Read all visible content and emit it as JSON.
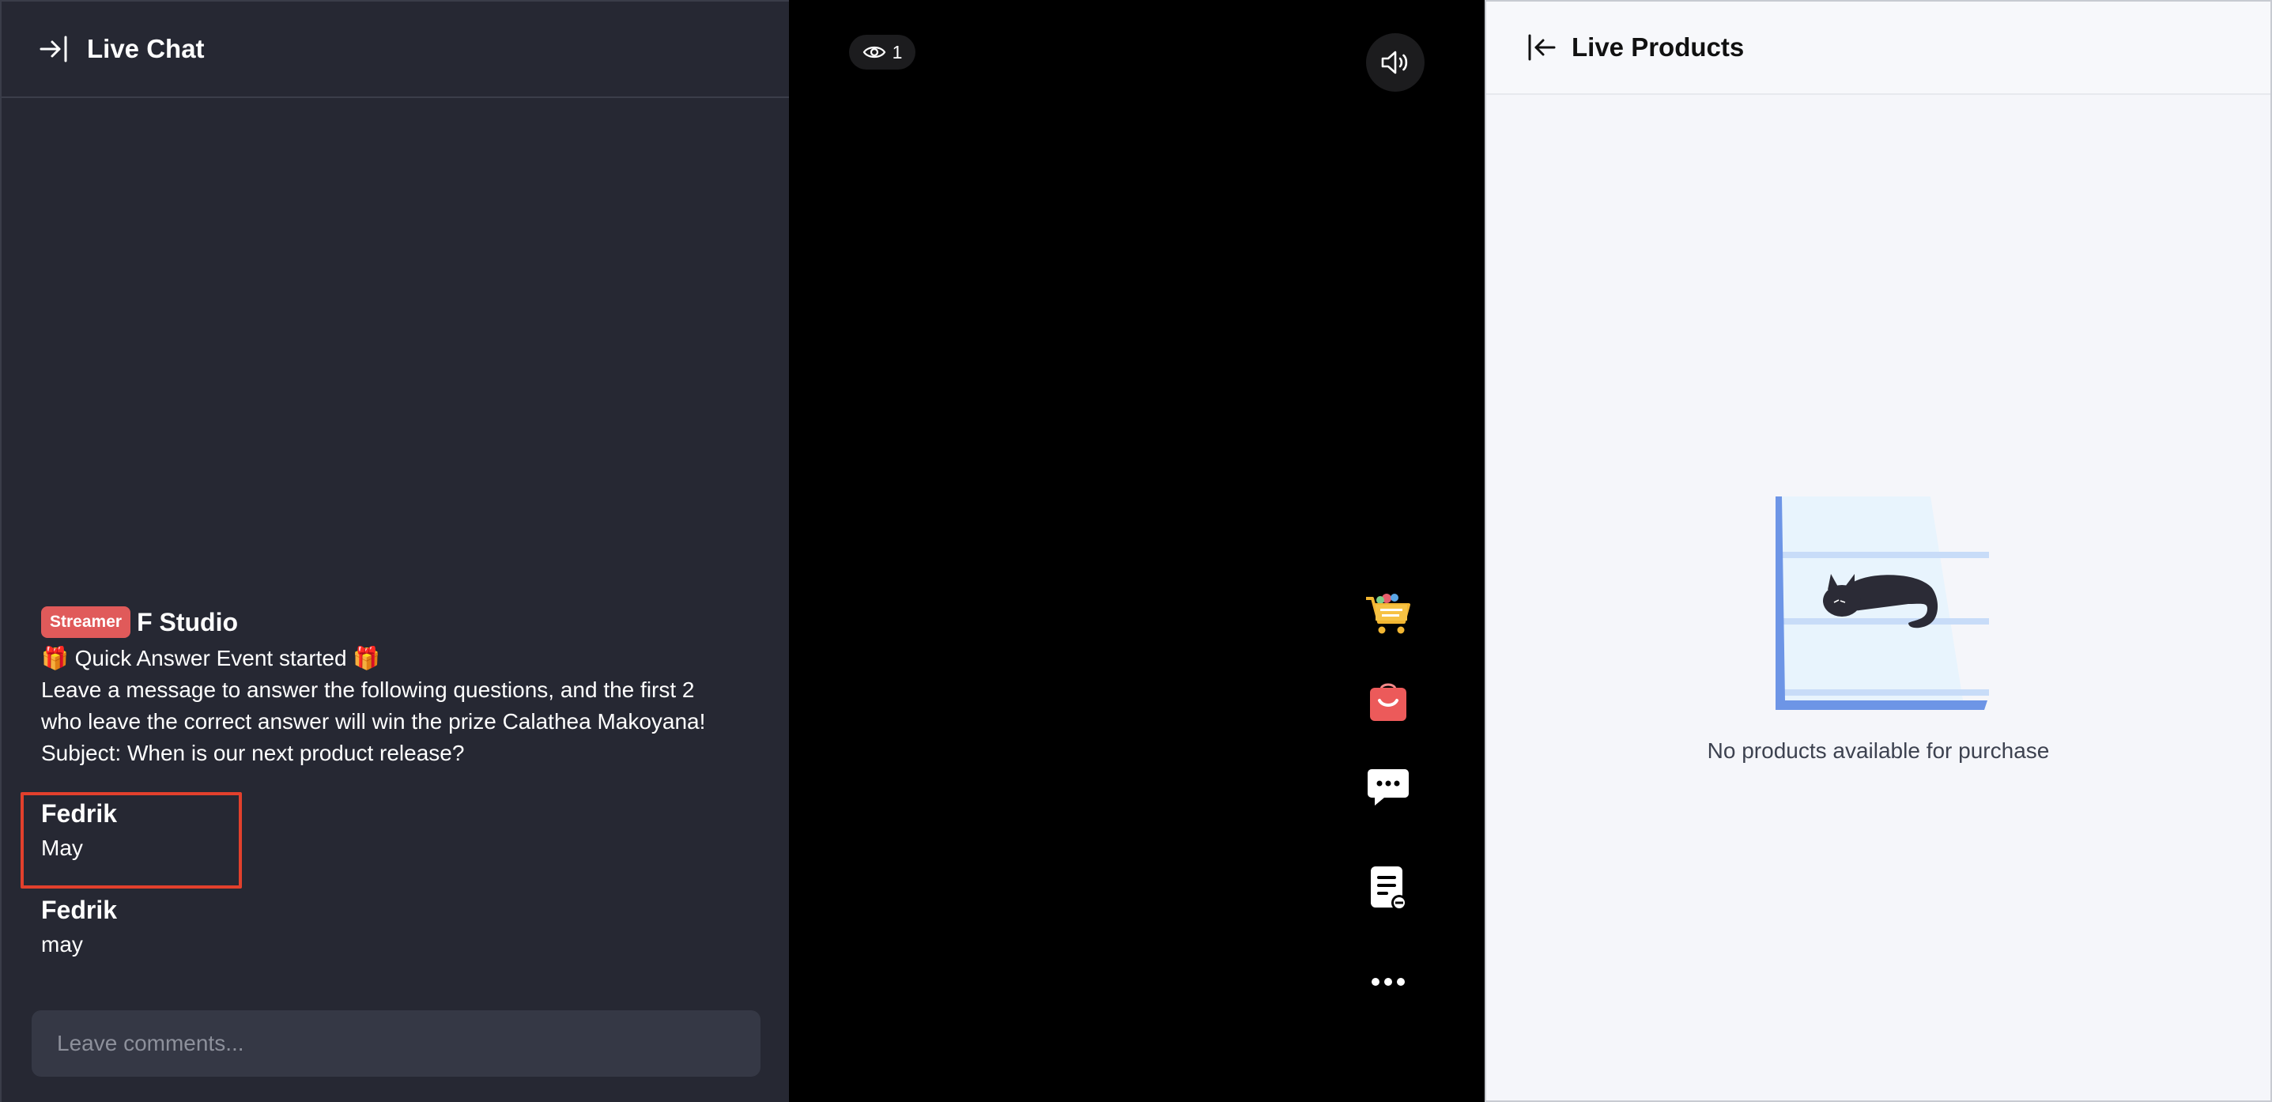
{
  "chat": {
    "title": "Live Chat",
    "streamer_badge": "Streamer",
    "streamer_name": "F Studio",
    "streamer_message": [
      "🎁 Quick Answer Event started 🎁",
      "Leave a message to answer the following questions, and the first 2",
      "who leave the correct answer will win the prize Calathea Makoyana!",
      "Subject: When is our next product release?"
    ],
    "comments": [
      {
        "user": "Fedrik",
        "text": "May"
      },
      {
        "user": "Fedrik",
        "text": "may"
      }
    ],
    "input_placeholder": "Leave comments..."
  },
  "video": {
    "viewer_count": "1",
    "icons": [
      "eye-icon",
      "volume-icon",
      "cart-icon",
      "shopping-bag-icon",
      "chat-bubble-icon",
      "notes-icon",
      "more-icon"
    ]
  },
  "products": {
    "title": "Live Products",
    "empty_message": "No products available for purchase"
  },
  "colors": {
    "chat_bg": "#262833",
    "streamer_badge": "#e05a5a",
    "highlight_border": "#e2402c",
    "products_bg": "#f5f6fa"
  }
}
